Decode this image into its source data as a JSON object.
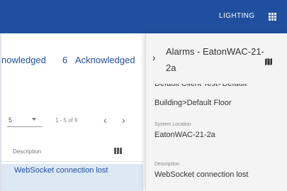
{
  "header": {
    "nav_label": "LIGHTING",
    "apps_icon": "apps-grid-icon"
  },
  "summary": {
    "unacknowledged_label_fragment": "nowledged",
    "acknowledged_count": "6",
    "acknowledged_label": "Acknowledged"
  },
  "pager": {
    "per_page": "5",
    "range": "1 - 5 of 6",
    "prev_glyph": "‹",
    "next_glyph": "›"
  },
  "table": {
    "column_header": "Description",
    "rows": [
      {
        "description": "WebSocket connection lost"
      }
    ]
  },
  "detail_panel": {
    "title": "Alarms - EatonWAC-21-2a",
    "breadcrumb_clipped": "Default Client Test>Default",
    "breadcrumb_tail": "Building>Default Floor",
    "system_location_label": "System Location",
    "system_location_value": "EatonWAC-21-2a",
    "description_label": "Description",
    "description_value": "WebSocket connection lost"
  },
  "colors": {
    "header_bg": "#1f4f9e",
    "accent": "#1f4f9e",
    "selected_row_bg": "#dde8f5",
    "panel_bg": "#f4f4f4"
  }
}
